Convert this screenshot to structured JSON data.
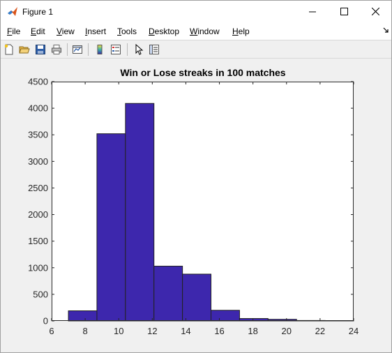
{
  "window": {
    "title": "Figure 1"
  },
  "menu": {
    "items": [
      {
        "label": "File",
        "key": "F",
        "rest": "ile"
      },
      {
        "label": "Edit",
        "key": "E",
        "rest": "dit"
      },
      {
        "label": "View",
        "key": "V",
        "rest": "iew"
      },
      {
        "label": "Insert",
        "key": "I",
        "rest": "nsert"
      },
      {
        "label": "Tools",
        "key": "T",
        "rest": "ools"
      },
      {
        "label": "Desktop",
        "key": "D",
        "rest": "esktop"
      },
      {
        "label": "Window",
        "key": "W",
        "rest": "indow"
      },
      {
        "label": "Help",
        "key": "H",
        "rest": "elp"
      }
    ]
  },
  "toolbar": {
    "icons": [
      "new-figure-icon",
      "open-file-icon",
      "save-icon",
      "print-icon",
      "link-plot-icon",
      "insert-colorbar-icon",
      "insert-legend-icon",
      "edit-plot-icon",
      "property-inspector-icon"
    ]
  },
  "chart_data": {
    "type": "bar",
    "title": "Win or Lose streaks in 100 matches",
    "xlabel": "",
    "ylabel": "",
    "xlim": [
      6,
      24
    ],
    "ylim": [
      0,
      4500
    ],
    "xticks": [
      6,
      8,
      10,
      12,
      14,
      16,
      18,
      20,
      22,
      24
    ],
    "yticks": [
      0,
      500,
      1000,
      1500,
      2000,
      2500,
      3000,
      3500,
      4000,
      4500
    ],
    "bins": [
      {
        "x0": 7.0,
        "x1": 8.7,
        "value": 190
      },
      {
        "x0": 8.7,
        "x1": 10.4,
        "value": 3520
      },
      {
        "x0": 10.4,
        "x1": 12.1,
        "value": 4090
      },
      {
        "x0": 12.1,
        "x1": 13.8,
        "value": 1030
      },
      {
        "x0": 13.8,
        "x1": 15.5,
        "value": 880
      },
      {
        "x0": 15.5,
        "x1": 17.2,
        "value": 200
      },
      {
        "x0": 17.2,
        "x1": 18.9,
        "value": 45
      },
      {
        "x0": 18.9,
        "x1": 20.6,
        "value": 30
      },
      {
        "x0": 20.6,
        "x1": 22.3,
        "value": 8
      },
      {
        "x0": 22.3,
        "x1": 24.0,
        "value": 3
      }
    ],
    "bar_color": "#3d27ad",
    "edge_color": "#222222",
    "grid": false
  }
}
